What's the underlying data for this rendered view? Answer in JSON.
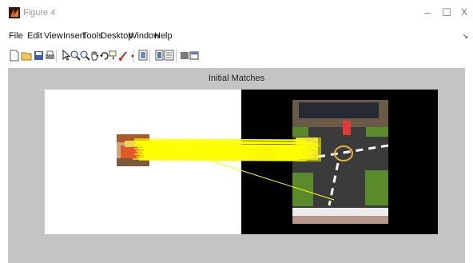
{
  "window": {
    "title": "Figure 4",
    "minimize_glyph": "–",
    "maximize_glyph": "☐",
    "close_glyph": "X"
  },
  "menu": {
    "items": [
      "File",
      "Edit",
      "View",
      "Insert",
      "Tools",
      "Desktop",
      "Window",
      "Help"
    ],
    "overflow_glyph": "↘"
  },
  "toolbar": {
    "buttons": [
      "new-figure-icon",
      "open-file-icon",
      "save-icon",
      "print-icon",
      "select-arrow-icon",
      "zoom-in-icon",
      "zoom-out-icon",
      "pan-hand-icon",
      "rotate-3d-icon",
      "data-cursor-icon",
      "brush-icon",
      "link-plot-icon",
      "insert-colorbar-icon",
      "insert-legend-icon",
      "hide-plot-tools-icon",
      "show-plot-tools-icon"
    ]
  },
  "axes": {
    "title": "Initial Matches"
  },
  "colors": {
    "figure_background": "#c4c4c4",
    "match_lines": "#ffff00",
    "right_panel": "#000000",
    "left_panel": "#ffffff"
  }
}
